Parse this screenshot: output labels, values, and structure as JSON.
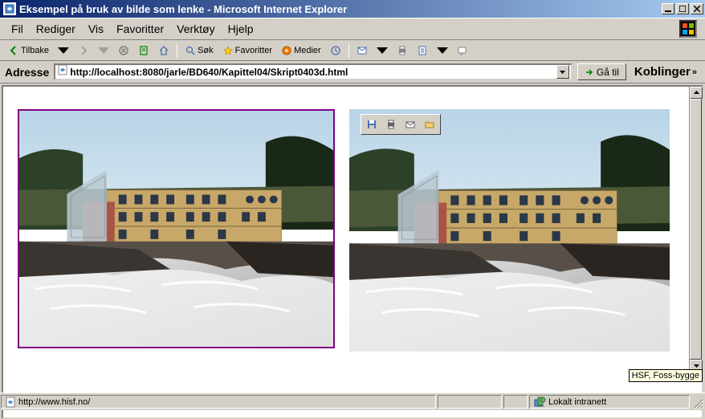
{
  "title": "Eksempel på bruk av bilde som lenke - Microsoft Internet Explorer",
  "menu": {
    "fil": "Fil",
    "rediger": "Rediger",
    "vis": "Vis",
    "favoritter": "Favoritter",
    "verktoy": "Verktøy",
    "hjelp": "Hjelp"
  },
  "toolbar": {
    "back": "Tilbake",
    "search": "Søk",
    "favorites": "Favoritter",
    "media": "Medier"
  },
  "address": {
    "label": "Adresse",
    "url": "http://localhost:8080/jarle/BD640/Kapittel04/Skript0403d.html",
    "go": "Gå til",
    "links": "Koblinger"
  },
  "status": {
    "url": "http://www.hisf.no/",
    "zone": "Lokalt intranett"
  },
  "tooltip": "HSF, Foss-bygge",
  "icons": {
    "save": "save-icon",
    "print": "print-icon",
    "mail": "mail-icon",
    "folder": "folder-icon"
  }
}
